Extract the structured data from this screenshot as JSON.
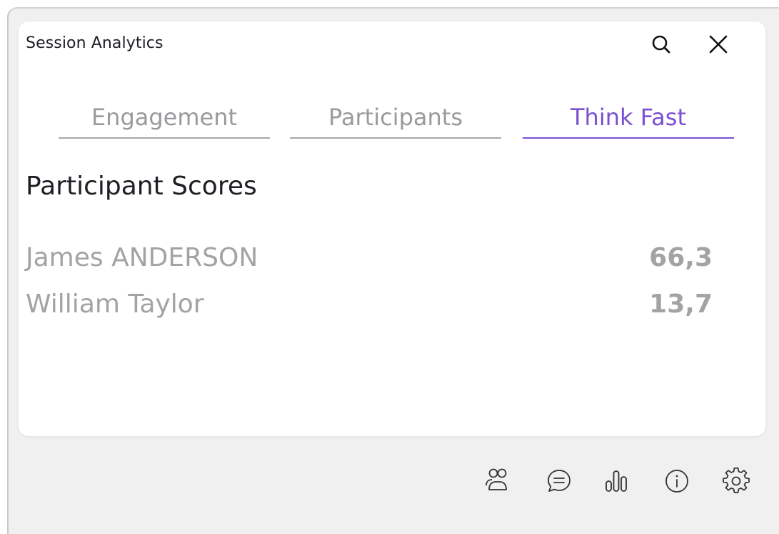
{
  "panel": {
    "title": "Session Analytics",
    "header_icons": [
      "search-icon",
      "close-icon"
    ]
  },
  "tabs": [
    {
      "label": "Engagement",
      "active": false
    },
    {
      "label": "Participants",
      "active": false
    },
    {
      "label": "Think Fast",
      "active": true
    }
  ],
  "section": {
    "title": "Participant Scores"
  },
  "scores": [
    {
      "name": "James ANDERSON",
      "score": "66,3"
    },
    {
      "name": "William Taylor",
      "score": "13,7"
    }
  ],
  "toolbar": {
    "icons": [
      "participants-icon",
      "chat-icon",
      "analytics-icon",
      "info-icon",
      "settings-icon"
    ]
  },
  "colors": {
    "accent": "#7c4fd1",
    "text_dark": "#1e1e24",
    "text_muted": "#a3a3a6",
    "panel_bg": "#f0f0f1"
  }
}
